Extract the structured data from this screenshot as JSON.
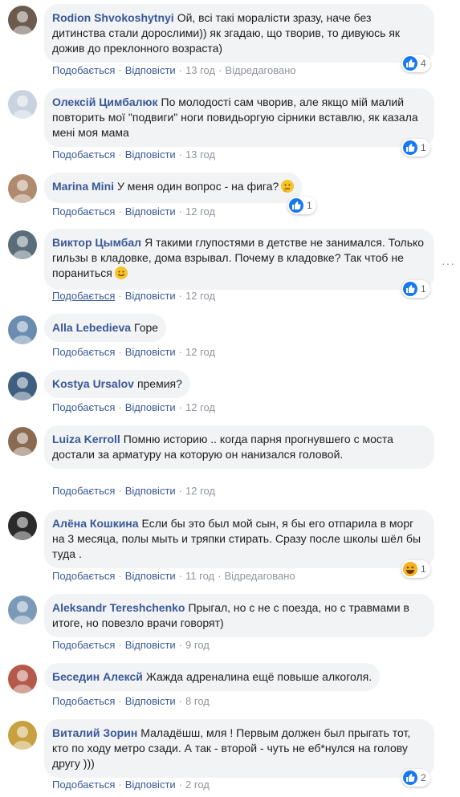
{
  "labels": {
    "like": "Подобається",
    "reply": "Відповісти",
    "edited": "Відредаговано",
    "sep": "·"
  },
  "colors": {
    "author": "#385898",
    "bubble": "#f2f3f5",
    "meta": "#90949c",
    "like_blue": "#1877f2"
  },
  "comments": [
    {
      "author": "Rodion Shvokoshytnyi",
      "text": "Ой, всі такі моралісти зразу, наче без дитинства стали дорослими)) як згадаю, що творив, то дивуюсь як дожив до преклонного возраста)",
      "time": "13 год",
      "edited": true,
      "reaction": "like-icon",
      "reaction_count": "4"
    },
    {
      "author": "Олексій Цимбалюк",
      "text": "По молодості сам чворив, але якщо мій малий повторить мої \"подвиги\" ноги повидьоргую сірники вставлю, як казала мені моя мама",
      "time": "13 год",
      "edited": false,
      "reaction": "like-icon",
      "reaction_count": "1"
    },
    {
      "author": "Marina Mini",
      "text": "У меня один вопрос - на фига?",
      "emoji": "thinking-face-icon",
      "time": "12 год",
      "edited": false,
      "reaction": "like-icon",
      "reaction_count": "1"
    },
    {
      "author": "Виктор Цымбал",
      "text": "Я такими глупостями в детстве не занимался. Только гильзы в кладовке, дома взрывал. Почему в кладовке? Так чтоб не пораниться",
      "emoji": "smiling-face-icon",
      "time": "12 год",
      "edited": false,
      "reaction": "like-icon",
      "reaction_count": "1"
    },
    {
      "author": "Alla Lebedieva",
      "text": "Горе",
      "time": "12 год",
      "edited": false
    },
    {
      "author": "Kostya Ursalov",
      "text": "премия?",
      "time": "12 год",
      "edited": false
    },
    {
      "author": "Luiza Kerroll",
      "text": "Помню историю .. когда парня прогнувшего с моста достали за арматуру на которую он нанизался головой.",
      "time": "12 год",
      "edited": false
    },
    {
      "author": "Алёна Кошкина",
      "text": "Если бы это был мой сын, я бы его отпарила в морг на 3 месяца, полы мыть и тряпки стирать. Сразу после школы шёл бы туда .",
      "time": "11 год",
      "edited": true,
      "reaction": "haha-icon",
      "reaction_count": "1"
    },
    {
      "author": "Aleksandr Tereshchenko",
      "text": "Прыгал, но с не с поезда, но с травмами в итоге, но повезло врачи говорят)",
      "time": "9 год",
      "edited": false
    },
    {
      "author": "Беседин Алексй",
      "text": "Жажда адреналина ещё повыше алкоголя.",
      "time": "8 год",
      "edited": false
    },
    {
      "author": "Виталий Зорин",
      "text": "Маладёшш, мля ! Первым должен был прыгать тот, кто по ходу метро сзади. А так - второй - чуть не еб*нулся на голову другу )))",
      "time": "2 год",
      "edited": false,
      "reaction": "like-icon",
      "reaction_count": "2"
    }
  ]
}
